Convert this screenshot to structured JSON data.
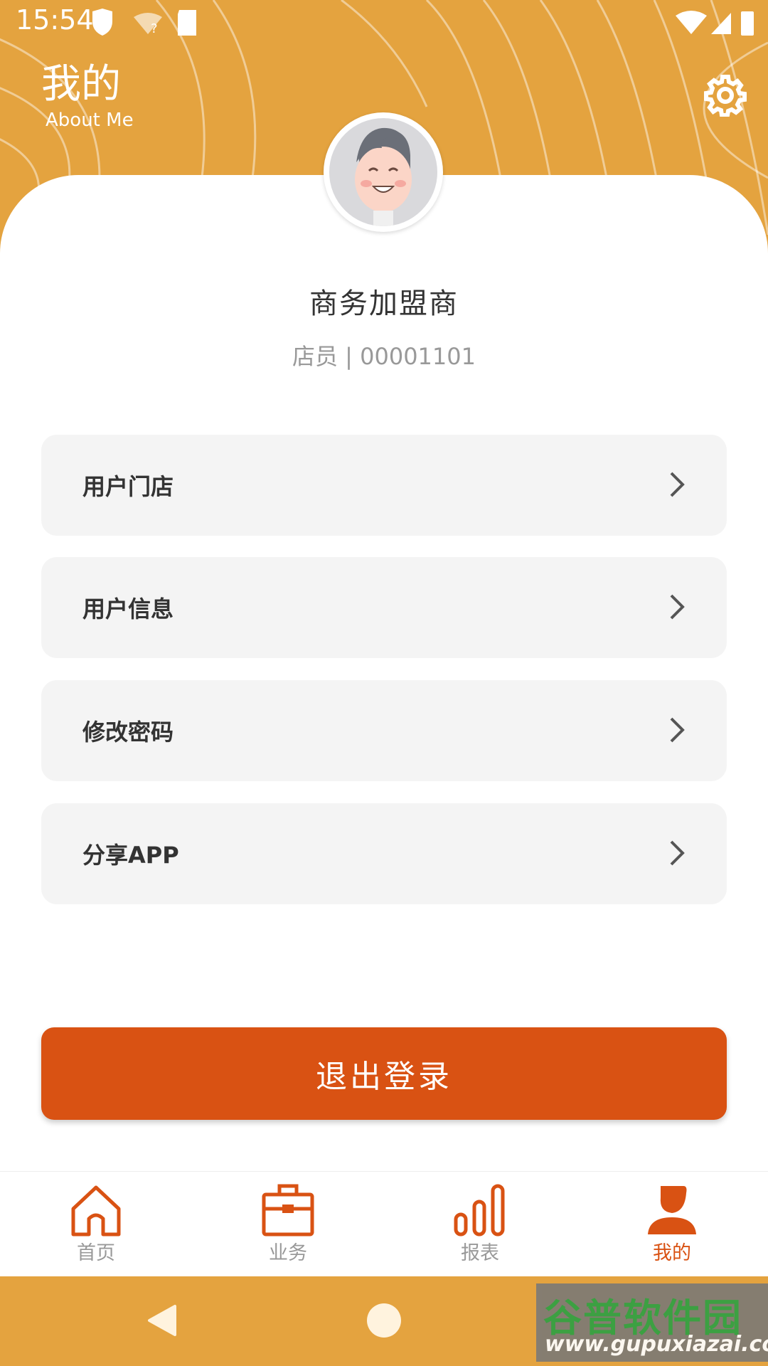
{
  "status_bar": {
    "time": "15:54"
  },
  "header": {
    "title": "我的",
    "subtitle": "About Me"
  },
  "profile": {
    "name": "商务加盟商",
    "role": "店员 | 00001101"
  },
  "menu": [
    {
      "label": "用户门店"
    },
    {
      "label": "用户信息"
    },
    {
      "label": "修改密码"
    },
    {
      "label": "分享APP"
    }
  ],
  "logout_label": "退出登录",
  "tabs": [
    {
      "label": "首页",
      "icon": "home-icon"
    },
    {
      "label": "业务",
      "icon": "briefcase-icon"
    },
    {
      "label": "报表",
      "icon": "bar-chart-icon"
    },
    {
      "label": "我的",
      "icon": "person-icon",
      "active": true
    }
  ],
  "watermark": {
    "title": "谷普软件园",
    "url": "www.gupuxiazai.com"
  },
  "colors": {
    "header": "#e4a33f",
    "accent": "#d95213",
    "card": "#f4f4f4"
  }
}
